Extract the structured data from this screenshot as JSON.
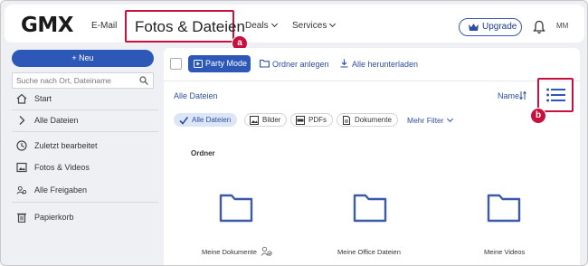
{
  "header": {
    "logo": "GMX",
    "nav": {
      "email": "E-Mail",
      "active": "Fotos & Dateien",
      "deals": "Deals",
      "services": "Services"
    },
    "upgrade_label": "Upgrade",
    "user_initials": "MM",
    "callout_a": "a"
  },
  "sidebar": {
    "new_button": "+ Neu",
    "search_placeholder": "Suche nach Ort, Dateiname",
    "items": [
      {
        "label": "Start",
        "icon": "home-icon"
      },
      {
        "label": "Alle Dateien",
        "icon": "chevron-right-icon"
      },
      {
        "label": "Zuletzt bearbeitet",
        "icon": "clock-icon"
      },
      {
        "label": "Fotos & Videos",
        "icon": "image-icon"
      },
      {
        "label": "Alle Freigaben",
        "icon": "share-users-icon"
      },
      {
        "label": "Papierkorb",
        "icon": "trash-icon"
      }
    ]
  },
  "toolbar": {
    "party_mode": "Party Mode",
    "create_folder": "Ordner anlegen",
    "download_all": "Alle herunterladen"
  },
  "content": {
    "breadcrumb": "Alle Dateien",
    "sort_label": "Name",
    "callout_b": "b",
    "filters": [
      {
        "label": "Alle Dateien",
        "active": true
      },
      {
        "label": "Bilder",
        "active": false
      },
      {
        "label": "PDFs",
        "active": false
      },
      {
        "label": "Dokumente",
        "active": false
      }
    ],
    "more_filter": "Mehr Filter",
    "section_title": "Ordner",
    "folders": [
      {
        "name": "Meine Dokumente",
        "shared": true
      },
      {
        "name": "Meine Office Dateien",
        "shared": false
      },
      {
        "name": "Meine Videos",
        "shared": false
      }
    ]
  },
  "colors": {
    "accent": "#2d58b8",
    "highlight": "#c8103e",
    "folder": "#3b5aa8"
  }
}
